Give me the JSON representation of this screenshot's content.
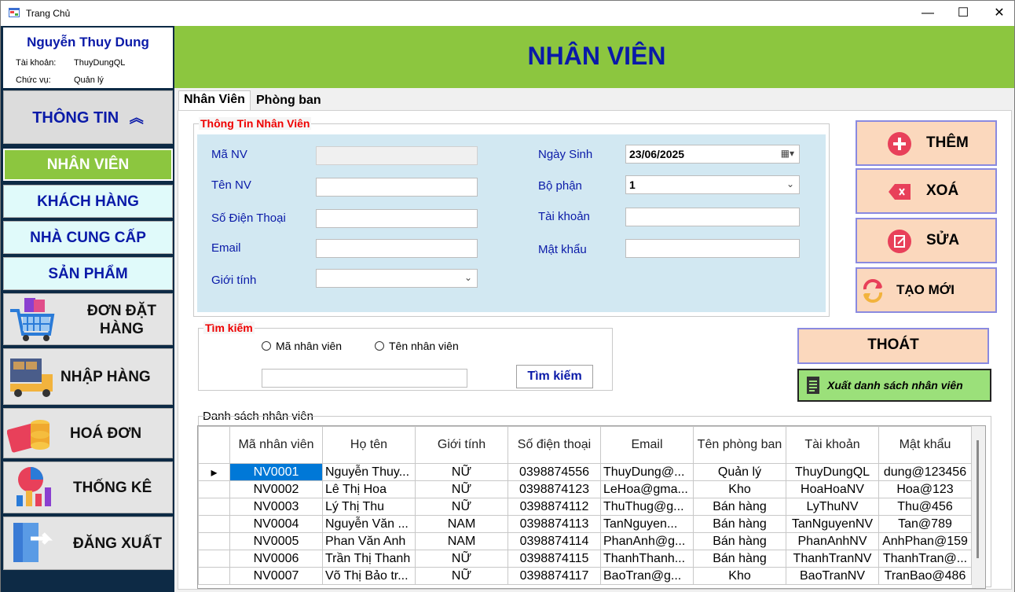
{
  "window": {
    "title": "Trang Chủ",
    "minimize": "—",
    "maximize": "☐",
    "close": "✕"
  },
  "user": {
    "name": "Nguyễn Thuy Dung",
    "account_label": "Tài khoản:",
    "account": "ThuyDungQL",
    "role_label": "Chức vụ:",
    "role": "Quản lý"
  },
  "sidebar": {
    "info": "THÔNG TIN",
    "items": [
      "NHÂN VIÊN",
      "KHÁCH HÀNG",
      "NHÀ CUNG CẤP",
      "SẢN PHẨM"
    ],
    "big_items": [
      "ĐƠN ĐẶT",
      "HÀNG",
      "NHẬP HÀNG",
      "HOÁ ĐƠN",
      "THỐNG KÊ",
      "ĐĂNG XUẤT"
    ]
  },
  "header": {
    "title": "NHÂN VIÊN"
  },
  "tabs": [
    "Nhân Viên",
    "Phòng ban"
  ],
  "form": {
    "group_title": "Thông Tin Nhân Viên",
    "labels": {
      "ma_nv": "Mã NV",
      "ten_nv": "Tên NV",
      "sdt": "Số Điện Thoại",
      "email": "Email",
      "gioi_tinh": "Giới tính",
      "ngay_sinh": "Ngày Sinh",
      "bo_phan": "Bộ phận",
      "tai_khoan": "Tài khoản",
      "mat_khau": "Mật khẩu"
    },
    "values": {
      "ngay_sinh": "23/06/2025",
      "bo_phan": "1"
    }
  },
  "actions": {
    "add": "THÊM",
    "delete": "XOÁ",
    "edit": "SỬA",
    "new": "TẠO MỚI",
    "exit": "THOÁT",
    "export": "Xuất danh sách nhân viên"
  },
  "search": {
    "group_title": "Tìm kiếm",
    "opt1": "Mã nhân viên",
    "opt2": "Tên nhân viên",
    "button": "Tìm kiếm"
  },
  "list": {
    "title": "Danh sách nhân viên",
    "columns": [
      "Mã nhân viên",
      "Họ tên",
      "Giới tính",
      "Số điện thoại",
      "Email",
      "Tên phòng ban",
      "Tài khoản",
      "Mật khẩu"
    ],
    "rows": [
      [
        "NV0001",
        "Nguyễn Thuy...",
        "NỮ",
        "0398874556",
        "ThuyDung@...",
        "Quản lý",
        "ThuyDungQL",
        "dung@123456"
      ],
      [
        "NV0002",
        "Lê Thị Hoa",
        "NỮ",
        "0398874123",
        "LeHoa@gma...",
        "Kho",
        "HoaHoaNV",
        "Hoa@123"
      ],
      [
        "NV0003",
        "Lý Thị Thu",
        "NỮ",
        "0398874112",
        "ThuThug@g...",
        "Bán hàng",
        "LyThuNV",
        "Thu@456"
      ],
      [
        "NV0004",
        "Nguyễn Văn ...",
        "NAM",
        "0398874113",
        "TanNguyen...",
        "Bán hàng",
        "TanNguyenNV",
        "Tan@789"
      ],
      [
        "NV0005",
        "Phan Văn Anh",
        "NAM",
        "0398874114",
        "PhanAnh@g...",
        "Bán hàng",
        "PhanAnhNV",
        "AnhPhan@159"
      ],
      [
        "NV0006",
        "Trần Thị Thanh",
        "NỮ",
        "0398874115",
        "ThanhThanh...",
        "Bán hàng",
        "ThanhTranNV",
        "ThanhTran@..."
      ],
      [
        "NV0007",
        "Võ Thị Bảo tr...",
        "NỮ",
        "0398874117",
        "BaoTran@g...",
        "Kho",
        "BaoTranNV",
        "TranBao@486"
      ]
    ]
  }
}
